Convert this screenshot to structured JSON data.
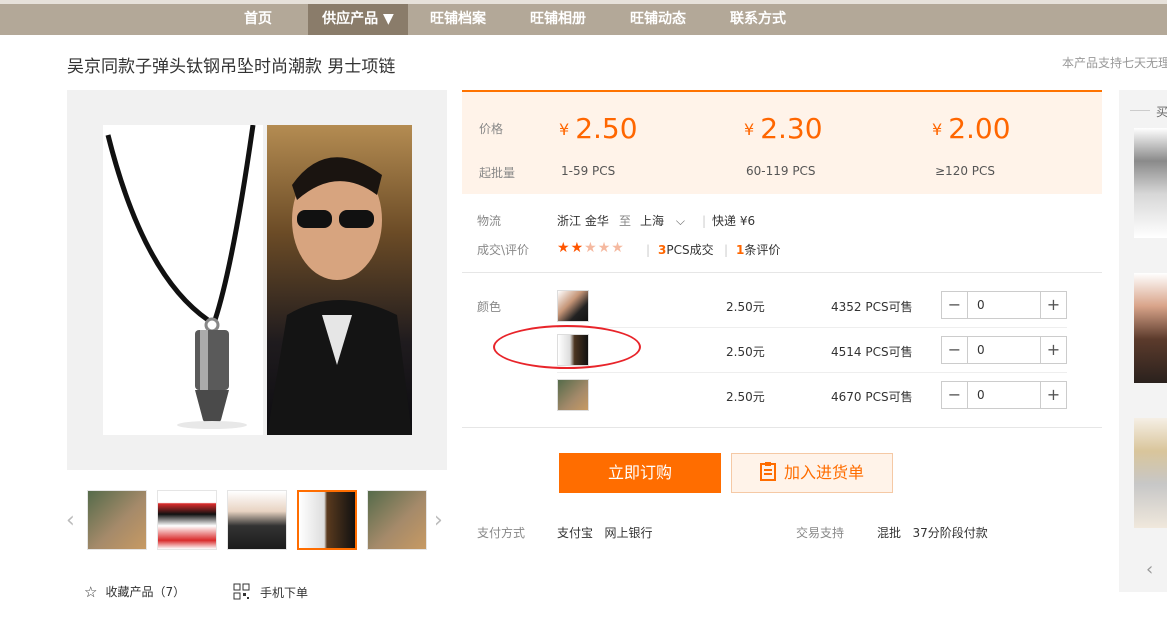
{
  "nav": {
    "items": [
      {
        "label": "首页"
      },
      {
        "label": "供应产品 ▼"
      },
      {
        "label": "旺铺档案"
      },
      {
        "label": "旺铺相册"
      },
      {
        "label": "旺铺动态"
      },
      {
        "label": "联系方式"
      }
    ]
  },
  "product": {
    "title": "吴京同款子弹头钛钢吊坠时尚潮款 男士项链",
    "return_note": "本产品支持七天无理"
  },
  "pricing": {
    "price_label": "价格",
    "qty_label": "起批量",
    "currency": "¥",
    "tiers": [
      {
        "price": "2.50",
        "qty": "1-59  PCS"
      },
      {
        "price": "2.30",
        "qty": "60-119  PCS"
      },
      {
        "price": "2.00",
        "qty": "≥120  PCS"
      }
    ]
  },
  "logistics": {
    "label": "物流",
    "from": "浙江 金华",
    "to_word": "至",
    "to": "上海",
    "shipping": "快递 ¥6"
  },
  "rating": {
    "label": "成交\\评价",
    "stars": 2,
    "max_stars": 5,
    "sold_count": "3",
    "sold_text": "PCS成交",
    "review_count": "1",
    "review_text": "条评价"
  },
  "variants": {
    "label": "颜色",
    "rows": [
      {
        "price": "2.50元",
        "stock": "4352 PCS可售",
        "qty": "0"
      },
      {
        "price": "2.50元",
        "stock": "4514 PCS可售",
        "qty": "0"
      },
      {
        "price": "2.50元",
        "stock": "4670 PCS可售",
        "qty": "0"
      }
    ]
  },
  "actions": {
    "buy_label": "立即订购",
    "cart_label": "加入进货单"
  },
  "payment": {
    "label": "支付方式",
    "methods": "支付宝   网上银行",
    "trade_label": "交易支持",
    "trade_text": "混批   37分阶段付款"
  },
  "gallery": {
    "favorite_label": "收藏产品（7）",
    "mobile_label": "手机下单"
  },
  "sidebar": {
    "title": "买"
  },
  "colors": {
    "accent": "#ff6d00",
    "nav_bg": "#b3a898",
    "price_bg": "#fff3e9"
  }
}
